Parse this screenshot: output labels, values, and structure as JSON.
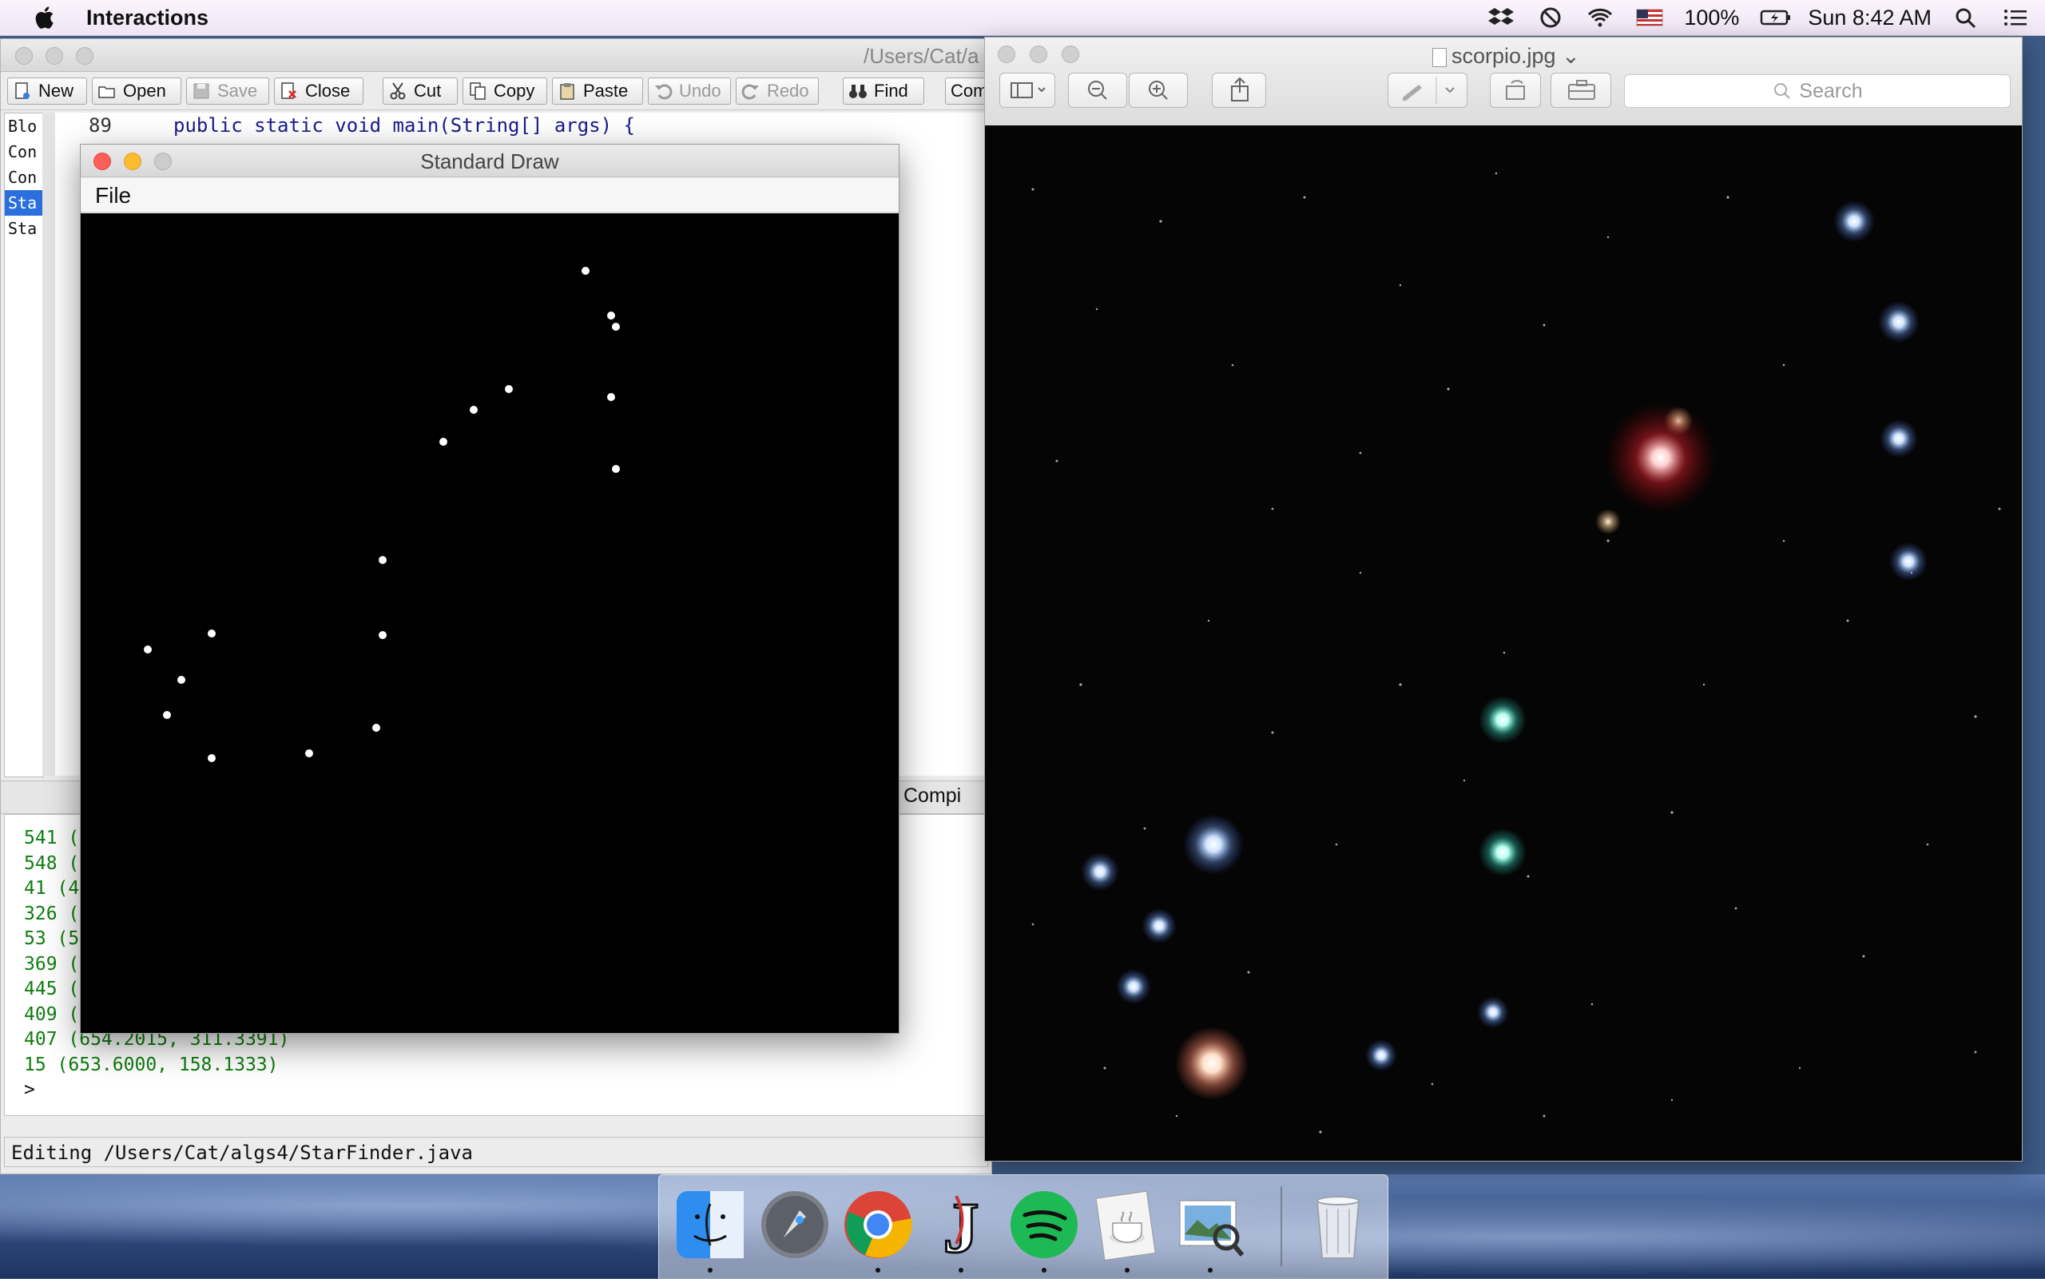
{
  "menubar": {
    "app_name": "Interactions",
    "battery": "100%",
    "clock": "Sun 8:42 AM"
  },
  "drjava": {
    "title": "/Users/Cat/a",
    "toolbar": {
      "new_label": "New",
      "open_label": "Open",
      "save_label": "Save",
      "close_label": "Close",
      "cut_label": "Cut",
      "copy_label": "Copy",
      "paste_label": "Paste",
      "undo_label": "Undo",
      "redo_label": "Redo",
      "find_label": "Find",
      "compile_label": "Com"
    },
    "file_list": [
      "Blo",
      "Con",
      "Con",
      "Sta",
      "Sta"
    ],
    "editor": {
      "line_number": "89",
      "line_89": "public static void main(String[] args) {"
    },
    "tab_compiler": "Compi",
    "console_lines": [
      "541 (",
      "548 (",
      "41 (4",
      "326 (",
      "53 (5",
      "369 (",
      "445 (",
      "409 (",
      "407 (654.2015, 311.3391)",
      "15 (653.6000, 158.1333)"
    ],
    "console_prompt": ">",
    "status": "Editing /Users/Cat/algs4/StarFinder.java"
  },
  "stddraw": {
    "title": "Standard Draw",
    "menu_file": "File"
  },
  "preview": {
    "title": "scorpio.jpg",
    "search_placeholder": "Search"
  }
}
